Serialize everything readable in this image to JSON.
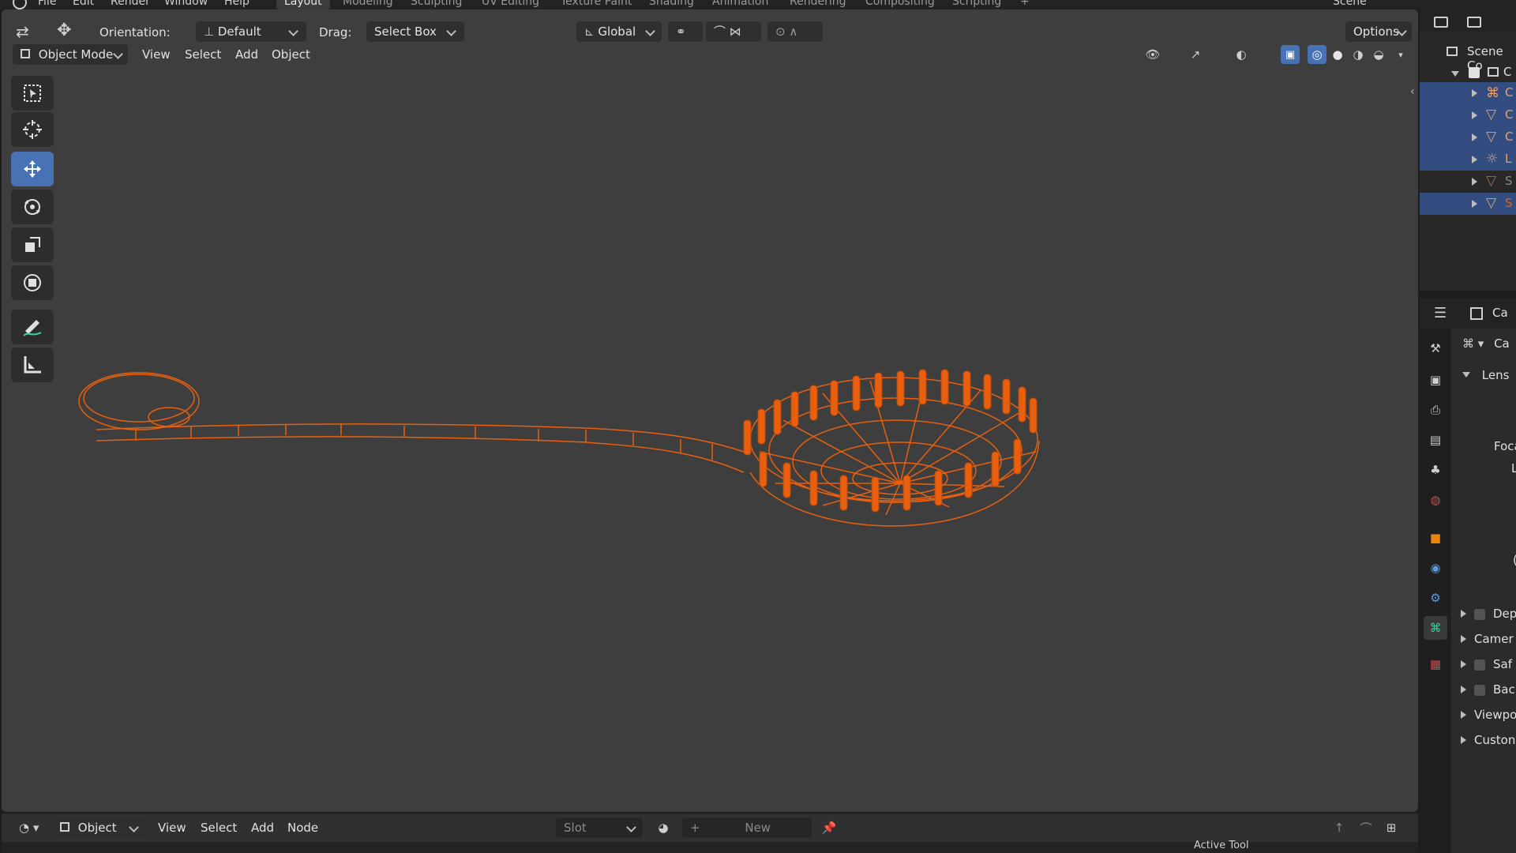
{
  "topbar": {
    "menus": [
      "File",
      "Edit",
      "Render",
      "Window",
      "Help"
    ],
    "workspaces": [
      "Layout",
      "Modeling",
      "Sculpting",
      "UV Editing",
      "Texture Paint",
      "Shading",
      "Animation",
      "Rendering",
      "Compositing",
      "Scripting"
    ],
    "active_workspace": "Layout",
    "add_workspace": "+",
    "scene_name": "Scene"
  },
  "tool_header": {
    "orientation_label": "Orientation:",
    "orientation_value": "Default",
    "drag_label": "Drag:",
    "drag_value": "Select Box",
    "transform_space": "Global",
    "options_label": "Options"
  },
  "view_header": {
    "mode": "Object Mode",
    "menus": [
      "View",
      "Select",
      "Add",
      "Object"
    ]
  },
  "toolbar": {
    "tools": [
      {
        "name": "select-box",
        "icon": "select-box-icon",
        "active": false
      },
      {
        "name": "cursor",
        "icon": "cursor-icon",
        "active": false
      },
      {
        "name": "move",
        "icon": "move-icon",
        "active": true
      },
      {
        "name": "rotate",
        "icon": "rotate-icon",
        "active": false
      },
      {
        "name": "scale",
        "icon": "scale-icon",
        "active": false
      },
      {
        "name": "transform",
        "icon": "transform-icon",
        "active": false
      },
      {
        "name": "annotate",
        "icon": "annotate-icon",
        "active": false
      },
      {
        "name": "measure",
        "icon": "measure-icon",
        "active": false
      }
    ]
  },
  "outliner": {
    "root_label": "Scene Co",
    "collection_label": "C",
    "items": [
      {
        "label": "C",
        "icon": "camera-object-icon",
        "selected": true
      },
      {
        "label": "C",
        "icon": "mesh-object-icon",
        "selected": true
      },
      {
        "label": "C",
        "icon": "mesh-object-icon",
        "selected": true
      },
      {
        "label": "L",
        "icon": "light-object-icon",
        "selected": true
      },
      {
        "label": "S",
        "icon": "mesh-object-icon",
        "selected": false
      },
      {
        "label": "S",
        "icon": "mesh-object-icon",
        "selected": true
      }
    ]
  },
  "properties": {
    "header_label": "Ca",
    "data_label": "Ca",
    "lens_panel": "Lens",
    "lens_fields": [
      "Foca",
      "L",
      "("
    ],
    "panels": [
      {
        "label": "Dep",
        "checkbox": true
      },
      {
        "label": "Camer",
        "checkbox": false
      },
      {
        "label": "Saf",
        "checkbox": true
      },
      {
        "label": "Bac",
        "checkbox": true
      },
      {
        "label": "Viewpo",
        "checkbox": false
      },
      {
        "label": "Custon",
        "checkbox": false
      }
    ]
  },
  "shader_header": {
    "editor_mode": "Object",
    "menus": [
      "View",
      "Select",
      "Add",
      "Node"
    ],
    "slot_label": "Slot",
    "new_label": "New"
  },
  "bottom": {
    "active_tool_label": "Active Tool"
  },
  "colors": {
    "selection": "#e8600f",
    "accent": "#4772b3",
    "viewport_bg": "#3e3e3e"
  }
}
